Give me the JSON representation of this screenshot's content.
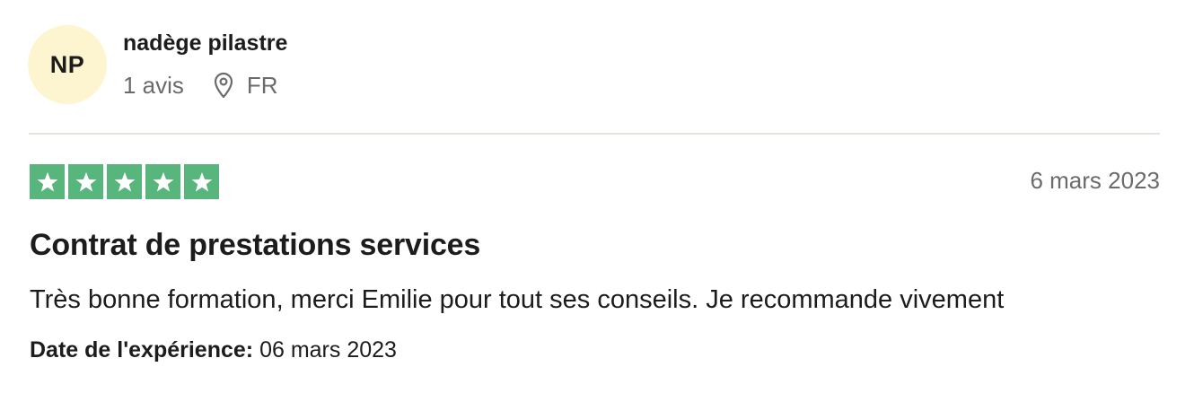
{
  "reviewer": {
    "initials": "NP",
    "name": "nadège pilastre",
    "review_count": "1 avis",
    "location_icon": "location-pin-icon",
    "country": "FR"
  },
  "review": {
    "rating": 5,
    "rating_max": 5,
    "star_icon": "star-icon",
    "date": "6 mars 2023",
    "title": "Contrat de prestations services",
    "body": "Très bonne formation, merci Emilie pour tout ses conseils. Je recommande vivement",
    "experience_label": "Date de l'expérience:",
    "experience_date": "06 mars 2023"
  },
  "colors": {
    "avatar_bg": "#fdf5d0",
    "star_green": "#58b67c",
    "muted_text": "#6b6b6b",
    "divider": "#e5e5dd"
  }
}
